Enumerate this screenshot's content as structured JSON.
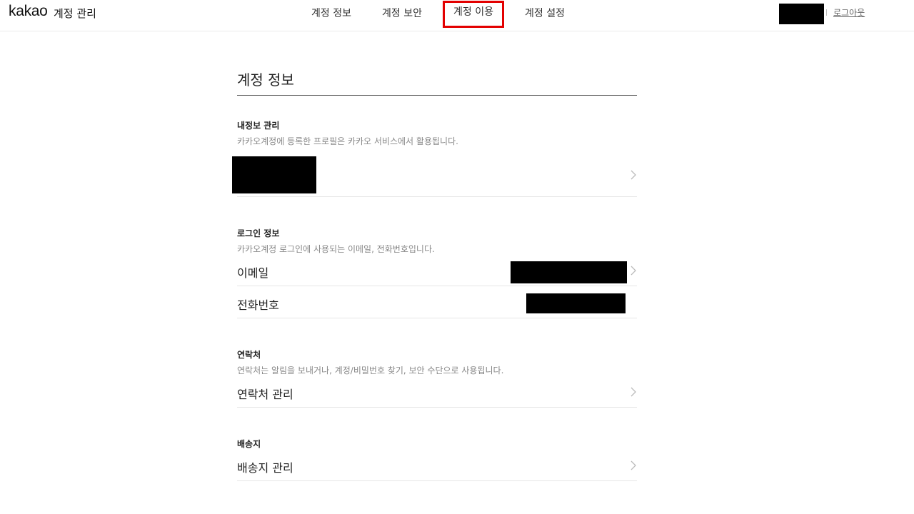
{
  "header": {
    "logo": "kakao",
    "service": "계정 관리",
    "tabs": [
      {
        "label": "계정 정보"
      },
      {
        "label": "계정 보안"
      },
      {
        "label": "계정 이용"
      },
      {
        "label": "계정 설정"
      }
    ],
    "logout": "로그아웃"
  },
  "main": {
    "title": "계정 정보",
    "profile": {
      "title": "내정보 관리",
      "desc": "카카오계정에 등록한 프로필은 카카오 서비스에서 활용됩니다."
    },
    "login": {
      "title": "로그인 정보",
      "desc": "카카오계정 로그인에 사용되는 이메일, 전화번호입니다.",
      "email_label": "이메일",
      "phone_label": "전화번호"
    },
    "contact": {
      "title": "연락처",
      "desc": "연락처는 알림을 보내거나, 계정/비밀번호 찾기, 보안 수단으로 사용됩니다.",
      "manage_label": "연락처 관리"
    },
    "shipping": {
      "title": "배송지",
      "manage_label": "배송지 관리"
    }
  },
  "colors": {
    "highlight_border": "#e30000",
    "redaction": "#000000"
  }
}
